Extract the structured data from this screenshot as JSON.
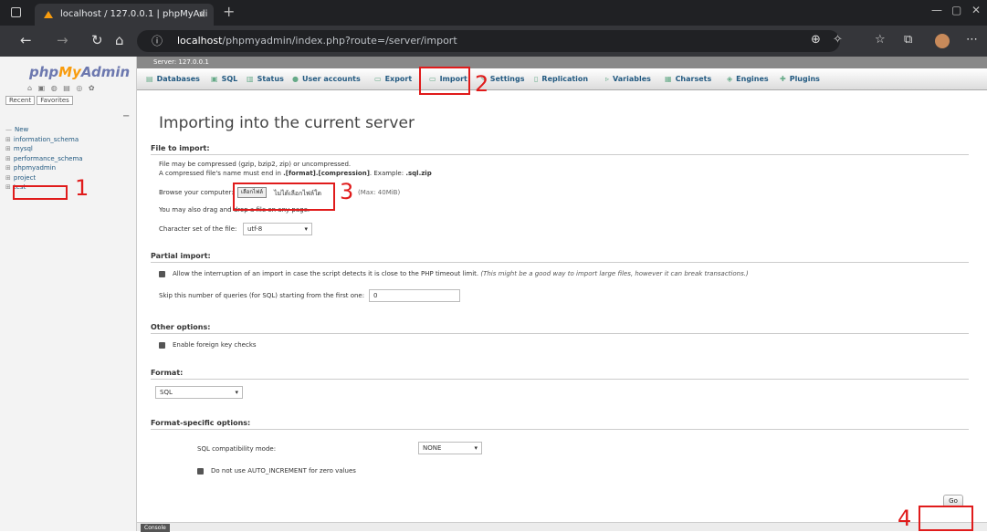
{
  "browser": {
    "tab_title": "localhost / 127.0.0.1 | phpMyAdi",
    "tab_close": "×",
    "new_tab": "+",
    "url_host": "localhost",
    "url_path": "/phpmyadmin/index.php?route=/server/import"
  },
  "sidebar": {
    "logo_php": "php",
    "logo_my": "My",
    "logo_admin": "Admin",
    "recent": "Recent",
    "favorites": "Favorites",
    "collapse": "−",
    "databases": [
      {
        "label": "New"
      },
      {
        "label": "information_schema"
      },
      {
        "label": "mysql"
      },
      {
        "label": "performance_schema"
      },
      {
        "label": "phpmyadmin"
      },
      {
        "label": "project"
      },
      {
        "label": "test"
      }
    ]
  },
  "main": {
    "server_label": "Server: 127.0.0.1",
    "menu": [
      {
        "label": "Databases"
      },
      {
        "label": "SQL"
      },
      {
        "label": "Status"
      },
      {
        "label": "User accounts"
      },
      {
        "label": "Export"
      },
      {
        "label": "Import"
      },
      {
        "label": "Settings"
      },
      {
        "label": "Replication"
      },
      {
        "label": "Variables"
      },
      {
        "label": "Charsets"
      },
      {
        "label": "Engines"
      },
      {
        "label": "Plugins"
      }
    ],
    "title": "Importing into the current server",
    "file_section": {
      "heading": "File to import:",
      "line1": "File may be compressed (gzip, bzip2, zip) or uncompressed.",
      "line2_pre": "A compressed file's name must end in ",
      "line2_format": ".[format].[compression]",
      "line2_mid": ". Example: ",
      "line2_example": ".sql.zip",
      "browse_label": "Browse your computer:",
      "choose_file": "เลือกไฟล์",
      "no_file": "ไม่ได้เลือกไฟล์ใด",
      "max": "(Max: 40MiB)",
      "drag_text": "You may also drag and drop a file on any page.",
      "charset_label": "Character set of the file:",
      "charset_value": "utf-8"
    },
    "partial_section": {
      "heading": "Partial import:",
      "allow_text": "Allow the interruption of an import in case the script detects it is close to the PHP timeout limit.",
      "allow_note": "(This might be a good way to import large files, however it can break transactions.)",
      "skip_label": "Skip this number of queries (for SQL) starting from the first one:",
      "skip_value": "0"
    },
    "other_section": {
      "heading": "Other options:",
      "fk_label": "Enable foreign key checks"
    },
    "format_section": {
      "heading": "Format:",
      "value": "SQL"
    },
    "specific_section": {
      "heading": "Format-specific options:",
      "compat_label": "SQL compatibility mode:",
      "compat_value": "NONE",
      "auto_inc_label": "Do not use AUTO_INCREMENT for zero values"
    },
    "go": "Go",
    "console": "Console"
  },
  "annotations": {
    "n1": "1",
    "n2": "2",
    "n3": "3",
    "n4": "4"
  },
  "colors": {
    "annotation": "#e01b1b",
    "logo_blue": "#6c78af",
    "logo_orange": "#f89c0e",
    "link": "#235a81"
  }
}
